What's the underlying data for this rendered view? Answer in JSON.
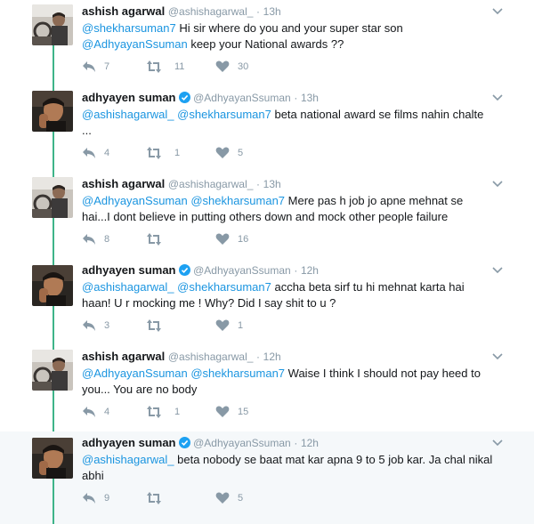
{
  "colors": {
    "accent": "#1b95e0",
    "thread": "#3eb489",
    "muted": "#8899a6",
    "verified": "#1da1f2"
  },
  "icons": {
    "reply": "reply-icon",
    "retweet": "retweet-icon",
    "like": "heart-icon",
    "more": "chevron-down-icon",
    "verified": "verified-badge-icon"
  },
  "tweets": [
    {
      "name": "ashish agarwal",
      "handle": "@ashishagarwal_",
      "sep": "·",
      "time": "13h",
      "verified": false,
      "l1": [
        {
          "t": "@shekharsuman7",
          "m": true
        },
        {
          "t": " Hi sir where do you and your super star son",
          "m": false
        }
      ],
      "l2": [
        {
          "t": "@AdhyayanSsuman",
          "m": true
        },
        {
          "t": " keep your National awards  ??",
          "m": false
        }
      ],
      "replies": "7",
      "retweets": "11",
      "likes": "30"
    },
    {
      "name": "adhyayen suman",
      "handle": "@AdhyayanSsuman",
      "sep": "·",
      "time": "13h",
      "verified": true,
      "l1": [
        {
          "t": "@ashishagarwal_",
          "m": true
        },
        {
          "t": " ",
          "m": false
        },
        {
          "t": "@shekharsuman7",
          "m": true
        },
        {
          "t": " beta national award se films nahin chalte",
          "m": false
        }
      ],
      "l2": [
        {
          "t": "...",
          "m": false
        }
      ],
      "replies": "4",
      "retweets": "1",
      "likes": "5"
    },
    {
      "name": "ashish agarwal",
      "handle": "@ashishagarwal_",
      "sep": "·",
      "time": "13h",
      "verified": false,
      "l1": [
        {
          "t": "@AdhyayanSsuman",
          "m": true
        },
        {
          "t": " ",
          "m": false
        },
        {
          "t": "@shekharsuman7",
          "m": true
        },
        {
          "t": " Mere pas h job jo apne mehnat se",
          "m": false
        }
      ],
      "l2": [
        {
          "t": "hai...I dont believe in putting others down and mock other people failure",
          "m": false
        }
      ],
      "replies": "8",
      "retweets": "",
      "likes": "16"
    },
    {
      "name": "adhyayen suman",
      "handle": "@AdhyayanSsuman",
      "sep": "·",
      "time": "12h",
      "verified": true,
      "l1": [
        {
          "t": "@ashishagarwal_",
          "m": true
        },
        {
          "t": " ",
          "m": false
        },
        {
          "t": "@shekharsuman7",
          "m": true
        },
        {
          "t": " accha beta sirf tu hi mehnat karta hai",
          "m": false
        }
      ],
      "l2": [
        {
          "t": "haan! U r mocking me ! Why? Did I say shit to u ?",
          "m": false
        }
      ],
      "replies": "3",
      "retweets": "",
      "likes": "1"
    },
    {
      "name": "ashish agarwal",
      "handle": "@ashishagarwal_",
      "sep": "·",
      "time": "12h",
      "verified": false,
      "l1": [
        {
          "t": "@AdhyayanSsuman",
          "m": true
        },
        {
          "t": " ",
          "m": false
        },
        {
          "t": "@shekharsuman7",
          "m": true
        },
        {
          "t": " Waise I think I should not pay heed to",
          "m": false
        }
      ],
      "l2": [
        {
          "t": "you... You are no body",
          "m": false
        }
      ],
      "replies": "4",
      "retweets": "1",
      "likes": "15"
    },
    {
      "name": "adhyayen suman",
      "handle": "@AdhyayanSsuman",
      "sep": "·",
      "time": "12h",
      "verified": true,
      "l1": [
        {
          "t": "@ashishagarwal_",
          "m": true
        },
        {
          "t": " beta nobody se baat mat kar apna 9 to 5 job kar. Ja chal nikal",
          "m": false
        }
      ],
      "l2": [
        {
          "t": "abhi",
          "m": false
        }
      ],
      "replies": "9",
      "retweets": "",
      "likes": "5"
    }
  ]
}
